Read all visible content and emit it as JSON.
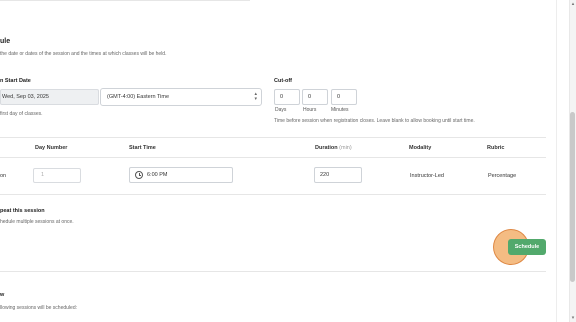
{
  "section": {
    "title": "ule",
    "description": "the date or dates of the session and the times at which classes will be held."
  },
  "start_date": {
    "label": "n Start Date",
    "value": "Wed, Sep 03, 2025",
    "help": "first day of classes."
  },
  "timezone": {
    "value": "(GMT-4:00) Eastern Time"
  },
  "cutoff": {
    "label": "Cut-off",
    "days": "0",
    "hours": "0",
    "minutes": "0",
    "days_label": "Days",
    "hours_label": "Hours",
    "minutes_label": "Minutes",
    "help": "Time before session when registration closes. Leave blank to allow booking until start time."
  },
  "table": {
    "headers": {
      "day_number": "Day Number",
      "start_time": "Start Time",
      "duration": "Duration",
      "duration_unit": "(min)",
      "modality": "Modality",
      "rubric": "Rubric"
    },
    "row": {
      "left_fragment": "on",
      "day_number": "1",
      "start_time": "6:00 PM",
      "duration": "220",
      "modality": "Instructor-Led",
      "rubric": "Percentage"
    }
  },
  "repeat": {
    "title": "peat this session",
    "description": "hedule multiple sessions at once."
  },
  "schedule_button": "Schedule",
  "preview": {
    "title": "w",
    "description": "llowing sessions will be scheduled:"
  }
}
